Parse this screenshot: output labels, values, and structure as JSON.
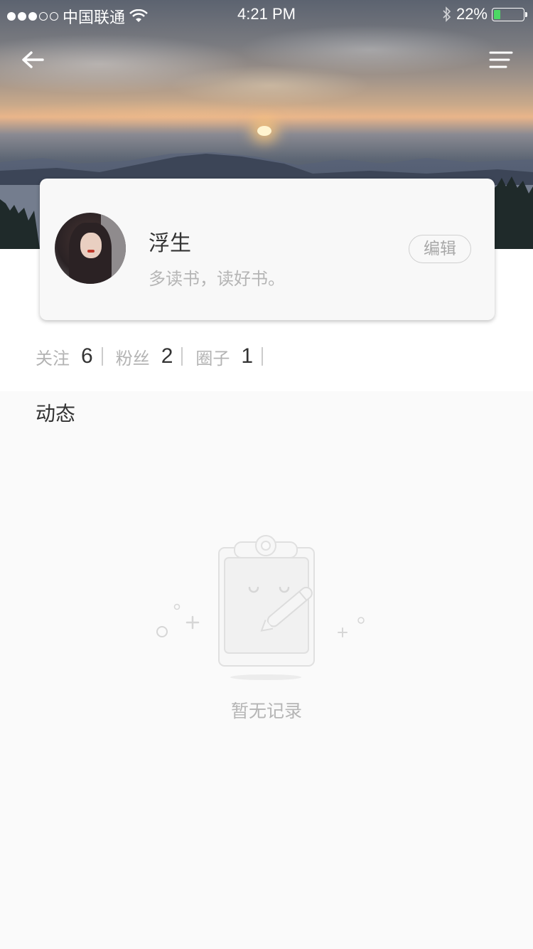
{
  "status_bar": {
    "carrier": "中国联通",
    "time": "4:21 PM",
    "battery": "22%",
    "battery_level": 0.22,
    "signal_bars_filled": 3,
    "signal_bars_total": 5
  },
  "header": {
    "back_icon": "arrow-left-icon",
    "menu_icon": "menu-lines-icon"
  },
  "profile": {
    "nickname": "浮生",
    "signature": "多读书，读好书。",
    "edit_label": "编辑"
  },
  "stats": [
    {
      "label": "关注",
      "value": "6"
    },
    {
      "label": "粉丝",
      "value": "2"
    },
    {
      "label": "圈子",
      "value": "1"
    }
  ],
  "feed": {
    "title": "动态",
    "empty_text": "暂无记录"
  },
  "colors": {
    "battery_fill": "#4cd964",
    "muted_text": "#b5b5b5",
    "primary_text": "#333333"
  }
}
